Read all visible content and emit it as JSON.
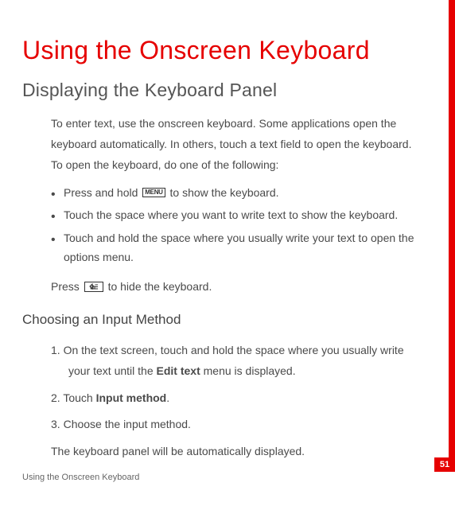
{
  "title": "Using the Onscreen Keyboard",
  "section1": {
    "heading": "Displaying the Keyboard Panel",
    "intro": "To enter text, use the onscreen keyboard. Some applications open the keyboard automatically. In others, touch a text field to open the keyboard. To open the keyboard, do one of the following:",
    "bullets": [
      {
        "pre": "Press and hold ",
        "icon": "MENU",
        "post": " to show the keyboard."
      },
      {
        "text": "Touch the space where you want to write text to show the keyboard."
      },
      {
        "text": "Touch and hold the space where you usually write your text to open the options menu."
      }
    ],
    "hide_pre": "Press ",
    "hide_post": " to hide the keyboard."
  },
  "section2": {
    "heading": "Choosing an Input Method",
    "steps": [
      {
        "num": "1.",
        "line1": "On the text screen, touch and hold the space where you usually write",
        "line2_pre": "your text until the ",
        "bold": "Edit text",
        "line2_post": " menu is displayed."
      },
      {
        "num": "2.",
        "pre": "Touch ",
        "bold": "Input method",
        "post": "."
      },
      {
        "num": "3.",
        "text": "Choose the input method."
      }
    ],
    "closing": "The keyboard panel will be automatically displayed."
  },
  "footer": "Using the Onscreen Keyboard",
  "page_number": "51"
}
